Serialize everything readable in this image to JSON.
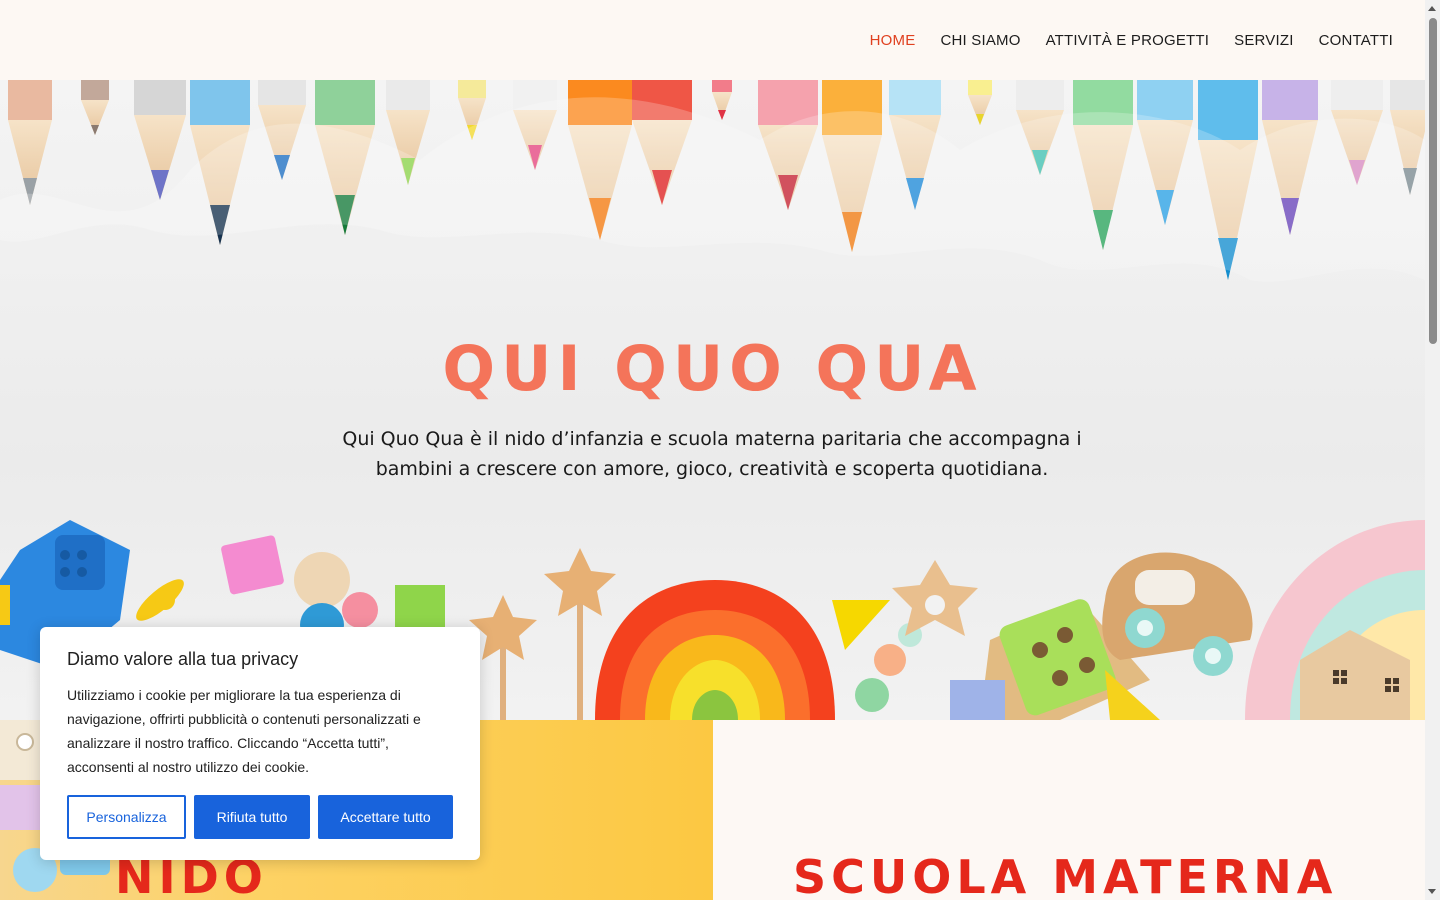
{
  "nav": {
    "items": [
      {
        "label": "HOME",
        "active": true
      },
      {
        "label": "CHI SIAMO",
        "active": false
      },
      {
        "label": "ATTIVITÀ E PROGETTI",
        "active": false
      },
      {
        "label": "SERVIZI",
        "active": false
      },
      {
        "label": "CONTATTI",
        "active": false
      }
    ]
  },
  "hero": {
    "title": "QUI QUO QUA",
    "subtitle": "Qui Quo Qua è il nido d’infanzia e scuola materna paritaria che accompagna i bambini a crescere con amore, gioco, creatività e scoperta quotidiana."
  },
  "sections": {
    "nido_title": "NIDO",
    "scuola_title": "SCUOLA MATERNA"
  },
  "cookie": {
    "title": "Diamo valore alla tua privacy",
    "text": "Utilizziamo i cookie per migliorare la tua esperienza di navigazione, offrirti pubblicità o contenuti personalizzati e analizzare il nostro traffico. Cliccando “Accetta tutti”, acconsenti al nostro utilizzo dei cookie.",
    "customize_label": "Personalizza",
    "reject_label": "Rifiuta tutto",
    "accept_label": "Accettare tutto"
  },
  "colors": {
    "accent": "#f4745a",
    "nav_active": "#e0401f",
    "section_title": "#e5281b",
    "button_blue": "#1863dc"
  }
}
